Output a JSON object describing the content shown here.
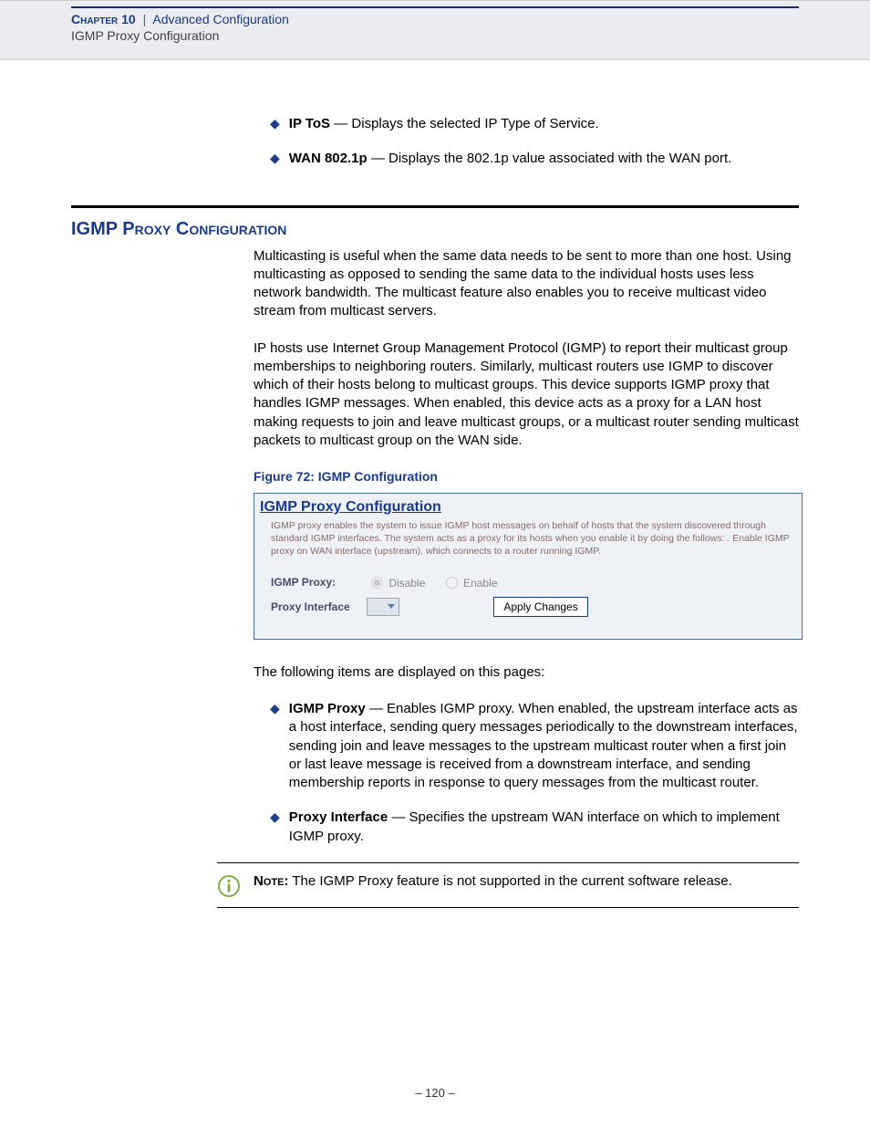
{
  "header": {
    "chapter_label": "Chapter",
    "chapter_number": "10",
    "separator": "|",
    "chapter_title": "Advanced Configuration",
    "subtitle": "IGMP Proxy Configuration"
  },
  "top_bullets": [
    {
      "term": "IP ToS",
      "desc": " — Displays the selected IP Type of Service."
    },
    {
      "term": "WAN 802.1p",
      "desc": " — Displays the 802.1p value associated with the WAN port."
    }
  ],
  "section": {
    "title": "IGMP Proxy Configuration",
    "para1": "Multicasting is useful when the same data needs to be sent to more than one host. Using multicasting as opposed to sending the same  data to the individual hosts uses less network bandwidth. The multicast feature also enables you to receive multicast video stream from multicast servers.",
    "para2": "IP hosts use Internet Group Management Protocol (IGMP) to report their multicast group memberships to neighboring routers. Similarly, multicast routers use IGMP to discover which of their hosts belong to multicast groups. This device supports IGMP proxy that handles IGMP messages. When enabled, this device acts as a proxy for a LAN host making requests to join and leave multicast groups, or a multicast router sending multicast packets to multicast group on the WAN side."
  },
  "figure": {
    "caption": "Figure 72:  IGMP Configuration",
    "panel_title": "IGMP Proxy Configuration",
    "panel_desc": "IGMP proxy enables the system to issue IGMP host messages on behalf of hosts that the system discovered through standard IGMP interfaces. The system acts as a proxy for its hosts when you enable it by doing the follows: . Enable IGMP proxy on WAN interface (upstream), which connects to a router running IGMP.",
    "row1_label": "IGMP Proxy:",
    "row1_opt_disable": "Disable",
    "row1_opt_enable": "Enable",
    "row2_label": "Proxy Interface",
    "apply_label": "Apply Changes"
  },
  "after_figure": {
    "intro": "The following items are displayed on this pages:",
    "bullets": [
      {
        "term": "IGMP Proxy",
        "desc": " — Enables IGMP proxy. When enabled, the upstream interface acts as a host interface, sending query messages periodically to the downstream interfaces, sending join and leave messages to the upstream multicast router when a first join or last leave message is received from a downstream interface, and sending membership reports in response to query messages from the multicast router."
      },
      {
        "term": "Proxy Interface",
        "desc": " — Specifies the upstream WAN interface on which to implement IGMP proxy."
      }
    ]
  },
  "note": {
    "label": "Note:",
    "text": " The IGMP Proxy feature is not supported in the current software release."
  },
  "page_number": "–  120  –"
}
